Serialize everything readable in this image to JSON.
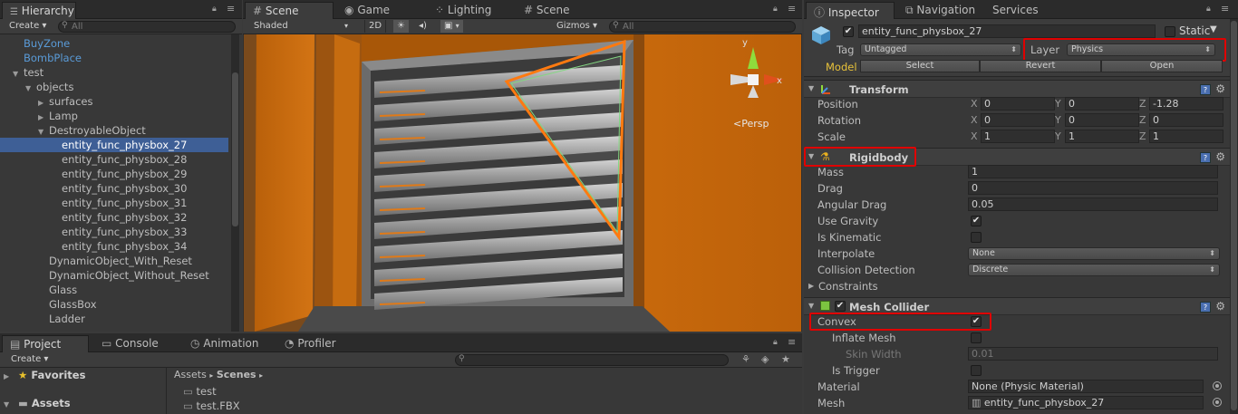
{
  "hierarchy": {
    "tab": "Hierarchy",
    "create": "Create ▾",
    "search_placeholder": "All",
    "items": [
      {
        "label": "BuyZone",
        "indent": 0,
        "color": "blue"
      },
      {
        "label": "BombPlace",
        "indent": 0,
        "color": "blue"
      },
      {
        "label": "test",
        "indent": 0,
        "arrow": "down"
      },
      {
        "label": "objects",
        "indent": 1,
        "arrow": "down"
      },
      {
        "label": "surfaces",
        "indent": 2,
        "arrow": "right"
      },
      {
        "label": "Lamp",
        "indent": 2,
        "arrow": "right"
      },
      {
        "label": "DestroyableObject",
        "indent": 2,
        "arrow": "down"
      },
      {
        "label": "entity_func_physbox_27",
        "indent": 3,
        "selected": true
      },
      {
        "label": "entity_func_physbox_28",
        "indent": 3
      },
      {
        "label": "entity_func_physbox_29",
        "indent": 3
      },
      {
        "label": "entity_func_physbox_30",
        "indent": 3
      },
      {
        "label": "entity_func_physbox_31",
        "indent": 3
      },
      {
        "label": "entity_func_physbox_32",
        "indent": 3
      },
      {
        "label": "entity_func_physbox_33",
        "indent": 3
      },
      {
        "label": "entity_func_physbox_34",
        "indent": 3
      },
      {
        "label": "DynamicObject_With_Reset",
        "indent": 2
      },
      {
        "label": "DynamicObject_Without_Reset",
        "indent": 2
      },
      {
        "label": "Glass",
        "indent": 2
      },
      {
        "label": "GlassBox",
        "indent": 2
      },
      {
        "label": "Ladder",
        "indent": 2
      }
    ]
  },
  "scene": {
    "tabs": [
      {
        "label": "Scene",
        "icon": "grid-icon",
        "active": true
      },
      {
        "label": "Game",
        "icon": "game-icon"
      },
      {
        "label": "Lighting",
        "icon": "lighting-icon"
      },
      {
        "label": "Scene",
        "icon": "grid-icon"
      }
    ],
    "shading": "Shaded",
    "mode_2d": "2D",
    "gizmos": "Gizmos ▾",
    "search_placeholder": "All",
    "persp_label": "Persp"
  },
  "project": {
    "tabs": [
      "Project",
      "Console",
      "Animation",
      "Profiler"
    ],
    "create": "Create ▾",
    "favorites": "Favorites",
    "assets": "Assets",
    "breadcrumb": [
      "Assets",
      "Scenes"
    ],
    "files": [
      {
        "label": "test",
        "icon": "folder-icon"
      },
      {
        "label": "test.FBX",
        "icon": "folder-icon"
      }
    ]
  },
  "inspector": {
    "tabs": [
      "Inspector",
      "Navigation",
      "Services"
    ],
    "object_name": "entity_func_physbox_27",
    "active_checked": true,
    "static_label": "Static",
    "tag_label": "Tag",
    "tag_value": "Untagged",
    "layer_label": "Layer",
    "layer_value": "Physics",
    "model_label": "Model",
    "model_buttons": [
      "Select",
      "Revert",
      "Open"
    ],
    "transform": {
      "title": "Transform",
      "rows": [
        {
          "label": "Position",
          "x": "0",
          "y": "0",
          "z": "-1.28"
        },
        {
          "label": "Rotation",
          "x": "0",
          "y": "0",
          "z": "0"
        },
        {
          "label": "Scale",
          "x": "1",
          "y": "1",
          "z": "1"
        }
      ]
    },
    "rigidbody": {
      "title": "Rigidbody",
      "mass_label": "Mass",
      "mass": "1",
      "drag_label": "Drag",
      "drag": "0",
      "angular_drag_label": "Angular Drag",
      "angular_drag": "0.05",
      "use_gravity_label": "Use Gravity",
      "use_gravity": true,
      "is_kinematic_label": "Is Kinematic",
      "is_kinematic": false,
      "interpolate_label": "Interpolate",
      "interpolate": "None",
      "collision_label": "Collision Detection",
      "collision": "Discrete",
      "constraints_label": "Constraints"
    },
    "mesh_collider": {
      "title": "Mesh Collider",
      "enabled": true,
      "convex_label": "Convex",
      "convex": true,
      "inflate_label": "Inflate Mesh",
      "inflate": false,
      "skin_label": "Skin Width",
      "skin": "0.01",
      "trigger_label": "Is Trigger",
      "trigger": false,
      "material_label": "Material",
      "material": "None (Physic Material)",
      "mesh_label": "Mesh",
      "mesh": "entity_func_physbox_27"
    }
  },
  "colors": {
    "selection": "#3e5f96",
    "highlight": "#e00000",
    "orange_wall": "#c46a0c",
    "blue_prefab": "#5a9bd8"
  }
}
